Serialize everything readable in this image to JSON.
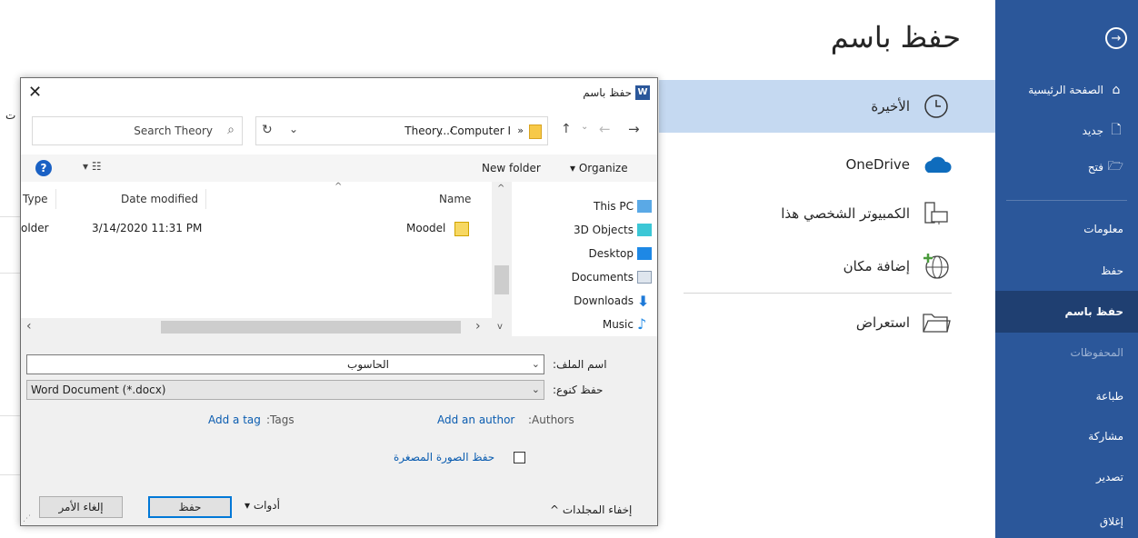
{
  "backstage": {
    "title": "حفظ باسم",
    "sidebar": {
      "items": [
        {
          "label": "الصفحة الرئيسية",
          "icon": "home-icon"
        },
        {
          "label": "جديد",
          "icon": "new-doc-icon"
        },
        {
          "label": "فتح",
          "icon": "open-folder-icon"
        },
        {
          "label": "معلومات"
        },
        {
          "label": "حفظ"
        },
        {
          "label": "حفظ باسم"
        },
        {
          "label": "المحفوظات"
        },
        {
          "label": "طباعة"
        },
        {
          "label": "مشاركة"
        },
        {
          "label": "تصدير"
        },
        {
          "label": "إغلاق"
        }
      ],
      "active": "حفظ باسم",
      "accent": "#2b579a"
    },
    "locations": [
      {
        "label": "الأخيرة",
        "icon": "clock-icon"
      },
      {
        "label": "OneDrive",
        "icon": "cloud-icon"
      },
      {
        "label": "الكمبيوتر الشخصي هذا",
        "icon": "pc-icon"
      },
      {
        "label": "إضافة مكان",
        "icon": "globe-add-icon"
      },
      {
        "label": "استعراض",
        "icon": "folder-icon"
      }
    ],
    "left_fragment": "ت"
  },
  "dialog": {
    "title": "حفظ باسم",
    "search_placeholder": "Search Theory",
    "breadcrumb": {
      "computer": "...Computer I",
      "sep": "»",
      "sep2": "‹",
      "current": "Theory"
    },
    "toolbar": {
      "organize": "Organize",
      "new_folder": "New folder"
    },
    "columns": {
      "name": "Name",
      "date": "Date modified",
      "type": "Type"
    },
    "rows": [
      {
        "name": "Moodel",
        "date": "3/14/2020 11:31 PM",
        "type": "older"
      }
    ],
    "nav_items": [
      "This PC",
      "3D Objects",
      "Desktop",
      "Documents",
      "Downloads",
      "Music"
    ],
    "filename_label": "اسم الملف:",
    "filename_value": "الحاسوب",
    "filetype_label": "حفظ كنوع:",
    "filetype_value": "Word Document (*.docx)",
    "authors_label": ":Authors",
    "authors_link": "Add an author",
    "tags_label": ":Tags",
    "tags_link": "Add a tag",
    "thumbnail_label": "حفظ الصورة المصغرة",
    "hide_folders": "إخفاء المجلدات",
    "tools": "أدوات",
    "save": "حفظ",
    "cancel": "إلغاء الأمر"
  }
}
